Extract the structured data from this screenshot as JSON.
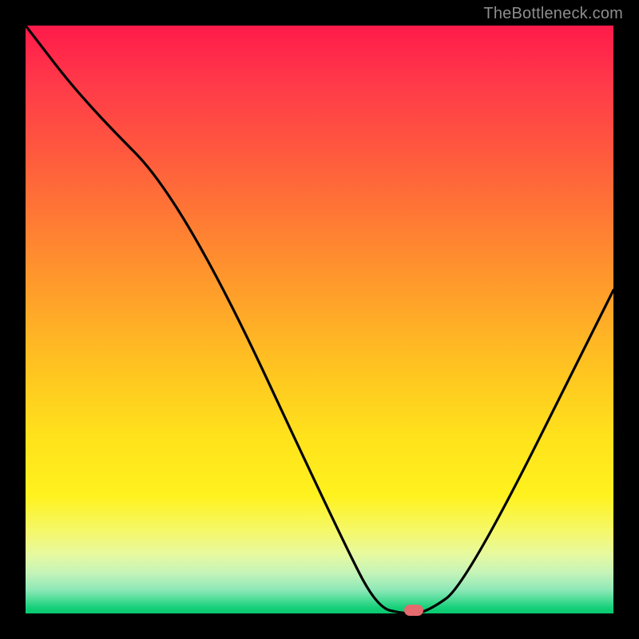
{
  "watermark": "TheBottleneck.com",
  "chart_data": {
    "type": "line",
    "title": "",
    "xlabel": "",
    "ylabel": "",
    "xlim": [
      0,
      100
    ],
    "ylim": [
      0,
      100
    ],
    "series": [
      {
        "name": "curve",
        "x": [
          0,
          10,
          27,
          55,
          60,
          64,
          68,
          75,
          100
        ],
        "values": [
          100,
          87,
          70,
          10,
          1,
          0,
          0,
          5,
          55
        ]
      }
    ],
    "marker": {
      "x": 66,
      "y": 0,
      "color": "#e46a6e"
    },
    "background_gradient": {
      "top": "#ff1a4a",
      "mid": "#ffe21c",
      "bottom": "#08c96e"
    }
  }
}
